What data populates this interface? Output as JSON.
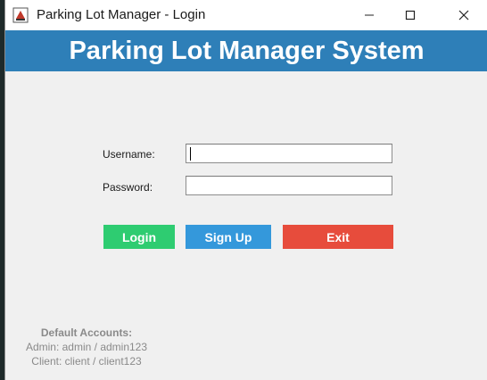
{
  "window": {
    "title": "Parking Lot Manager - Login",
    "icon": "java-app-icon"
  },
  "header": {
    "title": "Parking Lot Manager System",
    "background": "#2e7fb8"
  },
  "form": {
    "username_label": "Username:",
    "username_value": "",
    "password_label": "Password:",
    "password_value": ""
  },
  "buttons": {
    "login": {
      "label": "Login",
      "color": "#2ecc71"
    },
    "signup": {
      "label": "Sign Up",
      "color": "#3498db"
    },
    "exit": {
      "label": "Exit",
      "color": "#e74c3c"
    }
  },
  "defaults": {
    "title": "Default Accounts:",
    "admin": "Admin: admin / admin123",
    "client": "Client: client / client123"
  }
}
